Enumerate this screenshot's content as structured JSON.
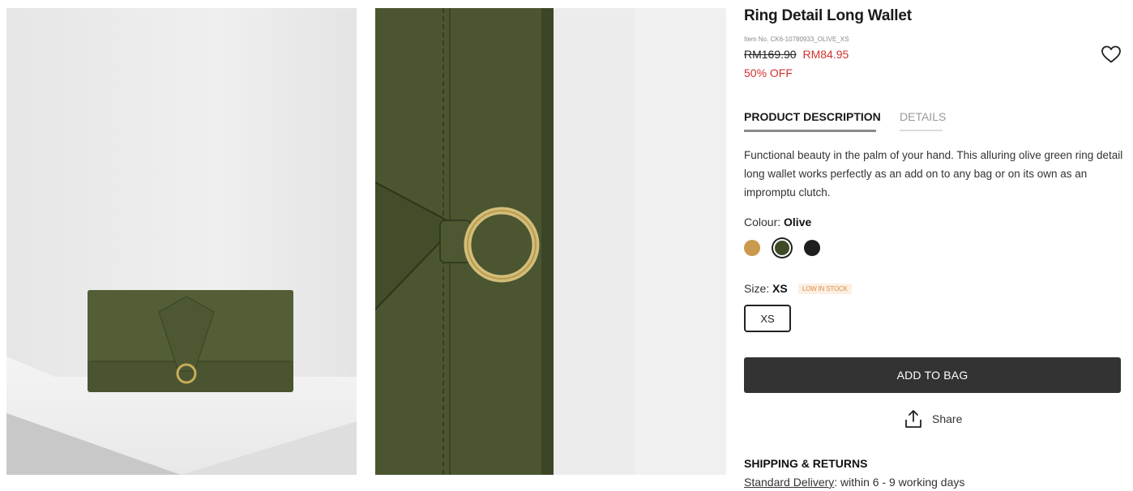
{
  "product": {
    "title": "Ring Detail Long Wallet",
    "item_no": "Item No. CK6-10780933_OLIVE_XS",
    "old_price": "RM169.90",
    "new_price": "RM84.95",
    "discount": "50% OFF"
  },
  "tabs": [
    {
      "label": "PRODUCT DESCRIPTION",
      "active": true
    },
    {
      "label": "DETAILS",
      "active": false
    }
  ],
  "description": "Functional beauty in the palm of your hand. This alluring olive green ring detail long wallet works perfectly as an add on to any bag or on its own as an impromptu clutch.",
  "colour": {
    "label": "Colour:",
    "selected": "Olive",
    "swatches": [
      {
        "name": "Tan",
        "color": "#c9994d"
      },
      {
        "name": "Olive",
        "color": "#3f4a26"
      },
      {
        "name": "Black",
        "color": "#1e1e1e"
      }
    ]
  },
  "size": {
    "label": "Size:",
    "selected": "XS",
    "stock": "LOW IN STOCK",
    "options": [
      "XS"
    ]
  },
  "actions": {
    "add_to_bag": "ADD TO BAG",
    "share": "Share"
  },
  "shipping": {
    "title": "SHIPPING & RETURNS",
    "delivery_link": "Standard Delivery",
    "delivery_text": ": within 6 - 9 working days"
  },
  "colors": {
    "accent_red": "#d0312d",
    "button_dark": "#333333",
    "badge_text": "#d98f4a"
  },
  "icons": [
    "heart-icon",
    "share-icon"
  ]
}
